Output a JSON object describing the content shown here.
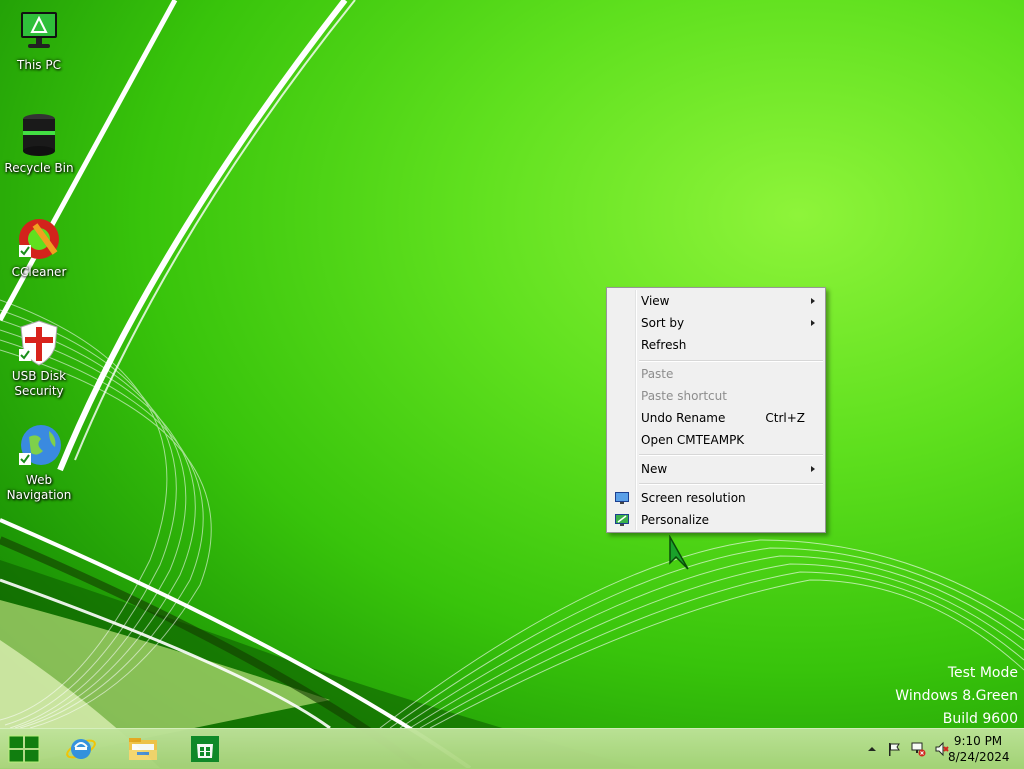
{
  "desktop": {
    "icons": [
      {
        "label": "This PC",
        "icon": "monitor-icon"
      },
      {
        "label": "Recycle Bin",
        "icon": "recycle-bin-icon"
      },
      {
        "label": "CCleaner",
        "icon": "ccleaner-icon"
      },
      {
        "label": "USB Disk Security",
        "icon": "shield-icon"
      },
      {
        "label": "Web Navigation",
        "icon": "globe-icon"
      }
    ]
  },
  "context_menu": {
    "view": "View",
    "sort_by": "Sort by",
    "refresh": "Refresh",
    "paste": "Paste",
    "paste_shortcut": "Paste shortcut",
    "undo_rename": "Undo Rename",
    "undo_shortcut": "Ctrl+Z",
    "open": "Open CMTEAMPK",
    "new": "New",
    "screen_resolution": "Screen resolution",
    "personalize": "Personalize"
  },
  "watermark": {
    "line1": "Test Mode",
    "line2": "Windows 8.Green",
    "line3": "Build 9600"
  },
  "taskbar": {
    "pinned": [
      "start-icon",
      "internet-explorer-icon",
      "file-explorer-icon",
      "store-icon"
    ],
    "tray": [
      "show-hidden-icons-icon",
      "action-center-flag-icon",
      "network-icon",
      "volume-muted-icon"
    ],
    "time": "9:10 PM",
    "date": "8/24/2024"
  },
  "colors": {
    "wallpaper_accent": "#5fe01e",
    "taskbar": "#a8d47a",
    "menu_bg": "#f0f0f0"
  }
}
